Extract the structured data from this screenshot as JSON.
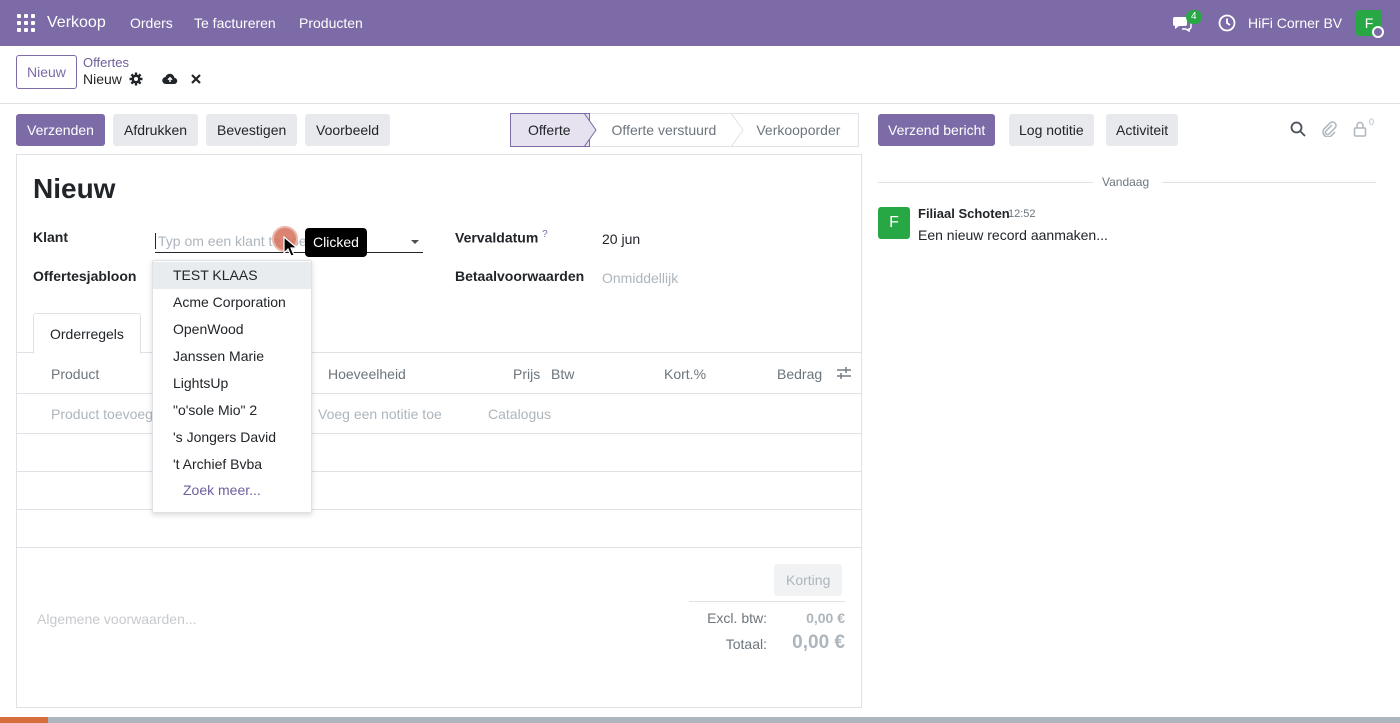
{
  "navbar": {
    "brand": "Verkoop",
    "menu": [
      "Orders",
      "Te factureren",
      "Producten"
    ],
    "chat_badge": "4",
    "company": "HiFi Corner BV",
    "avatar_letter": "F"
  },
  "control": {
    "new_label": "Nieuw",
    "breadcrumb_parent": "Offertes",
    "breadcrumb_current": "Nieuw"
  },
  "actions": {
    "send": "Verzenden",
    "print": "Afdrukken",
    "confirm": "Bevestigen",
    "preview": "Voorbeeld"
  },
  "status": {
    "stages": [
      "Offerte",
      "Offerte verstuurd",
      "Verkooporder"
    ],
    "active": "Offerte"
  },
  "form": {
    "title": "Nieuw",
    "klant_label": "Klant",
    "klant_placeholder": "Typ om een klant te zoeken...",
    "template_label": "Offertesjabloon",
    "due_label": "Vervaldatum",
    "due_help": "?",
    "due_value": "20 jun",
    "payment_label": "Betaalvoorwaarden",
    "payment_placeholder": "Onmiddellijk"
  },
  "tabs": [
    "Orderregels"
  ],
  "table": {
    "columns": [
      "Product",
      "Hoeveelheid",
      "Prijs",
      "Btw",
      "Kort.%",
      "Bedrag"
    ],
    "add_product": "Product toevoegen",
    "add_note": "Voeg een notitie toe",
    "catalog": "Catalogus"
  },
  "totals": {
    "discount_button": "Korting",
    "terms_placeholder": "Algemene voorwaarden...",
    "excl_label": "Excl. btw:",
    "excl_value": "0,00 €",
    "total_label": "Totaal:",
    "total_value": "0,00 €"
  },
  "dropdown": {
    "items": [
      "TEST KLAAS",
      "Acme Corporation",
      "OpenWood",
      "Janssen Marie",
      "LightsUp",
      "\"o'sole Mio\" 2",
      "'s Jongers David",
      "'t Archief Bvba"
    ],
    "more": "Zoek meer..."
  },
  "tooltip": "Clicked",
  "chatter": {
    "send_message": "Verzend bericht",
    "log_note": "Log notitie",
    "activity": "Activiteit",
    "followers": "0",
    "separator": "Vandaag",
    "message": {
      "avatar": "F",
      "author": "Filiaal Schoten",
      "time": "12:52",
      "body": "Een nieuw record aanmaken..."
    }
  },
  "colors": {
    "primary": "#7c6ba6",
    "success": "#28a745"
  },
  "progress": 0.034
}
